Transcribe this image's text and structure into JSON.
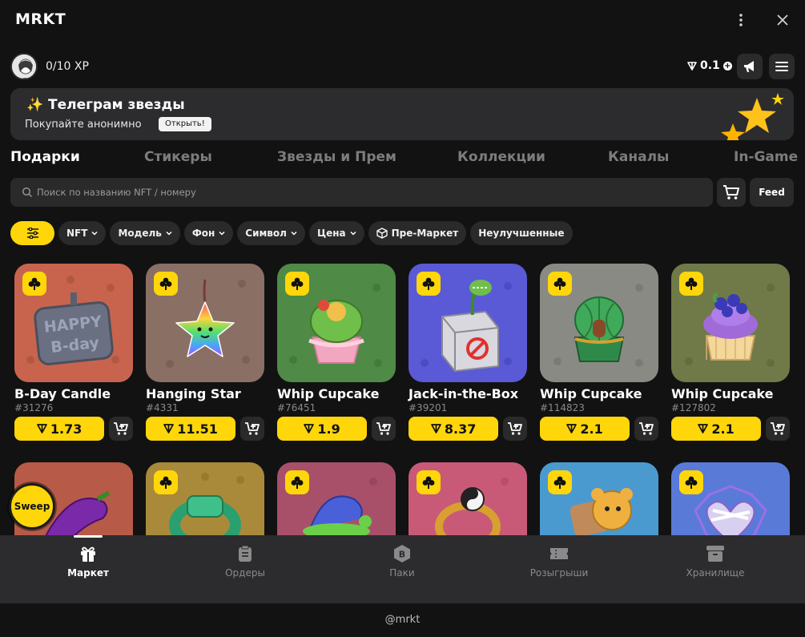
{
  "app": {
    "title": "MRKT"
  },
  "user": {
    "xp": "0/10 XP",
    "balance": "0.1"
  },
  "banner": {
    "title": "Телеграм звезды",
    "subtitle": "Покупайте анонимно",
    "button": "Открыть!"
  },
  "categories": [
    "Подарки",
    "Стикеры",
    "Звезды и Прем",
    "Коллекции",
    "Каналы",
    "In-Game"
  ],
  "search": {
    "placeholder": "Поиск по названию NFT / номеру"
  },
  "feed_label": "Feed",
  "filters": [
    "NFT",
    "Модель",
    "Фон",
    "Символ",
    "Цена",
    "Пре-Маркет",
    "Неулучшенные"
  ],
  "items": [
    {
      "name": "B-Day Candle",
      "number": "#31276",
      "price": "1.73"
    },
    {
      "name": "Hanging Star",
      "number": "#4331",
      "price": "11.51"
    },
    {
      "name": "Whip Cupcake",
      "number": "#76451",
      "price": "1.9"
    },
    {
      "name": "Jack-in-the-Box",
      "number": "#39201",
      "price": "8.37"
    },
    {
      "name": "Whip Cupcake",
      "number": "#114823",
      "price": "2.1"
    },
    {
      "name": "Whip Cupcake",
      "number": "#127802",
      "price": "2.1"
    }
  ],
  "sweep_label": "Sweep",
  "nav": [
    "Маркет",
    "Ордеры",
    "Паки",
    "Розыгрыши",
    "Хранилище"
  ],
  "footer": "@mrkt",
  "colors": {
    "accent": "#ffd60a",
    "background": "#121212",
    "surface": "#2a2a2a"
  }
}
